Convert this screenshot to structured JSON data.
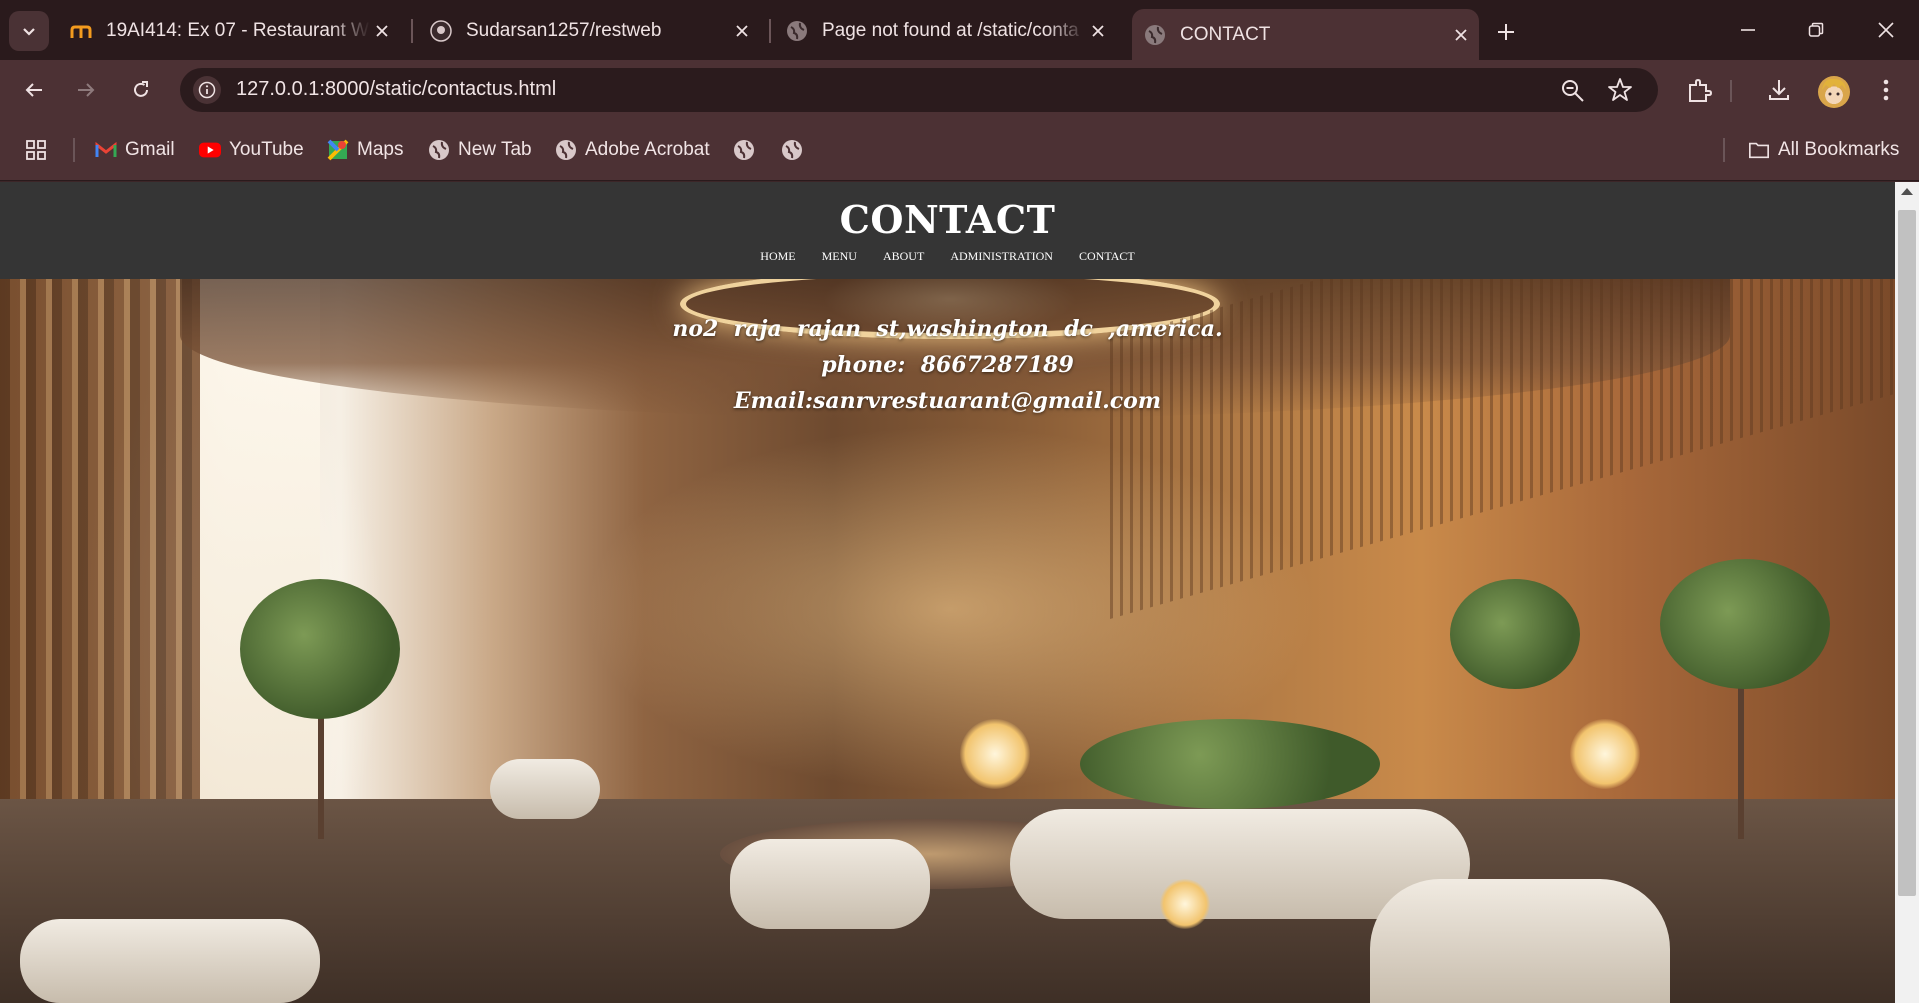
{
  "browser": {
    "tabs": [
      {
        "title": "19AI414: Ex 07 - Restaurant We",
        "favicon": "moodle-icon"
      },
      {
        "title": "Sudarsan1257/restweb",
        "favicon": "github-icon"
      },
      {
        "title": "Page not found at /static/conta",
        "favicon": "globe-icon"
      },
      {
        "title": "CONTACT",
        "favicon": "globe-icon",
        "active": true
      }
    ],
    "url": "127.0.0.1:8000/static/contactus.html",
    "bookmarks": [
      {
        "label": "Gmail",
        "icon": "gmail-icon"
      },
      {
        "label": "YouTube",
        "icon": "youtube-icon"
      },
      {
        "label": "Maps",
        "icon": "maps-icon"
      },
      {
        "label": "New Tab",
        "icon": "globe-icon"
      },
      {
        "label": "Adobe Acrobat",
        "icon": "globe-icon"
      },
      {
        "label": "",
        "icon": "globe-icon"
      },
      {
        "label": "",
        "icon": "globe-icon"
      }
    ],
    "all_bookmarks": "All Bookmarks",
    "colors": {
      "frame": "#2a1a1c",
      "toolbar": "#4c3134",
      "omnibox": "#2b1b1d"
    }
  },
  "site": {
    "title": "CONTACT",
    "nav": [
      "HOME",
      "MENU",
      "ABOUT",
      "ADMINISTRATION",
      "CONTACT"
    ],
    "contact": {
      "address": "no2  raja  rajan  st,washington  dc  ,america.",
      "phone": "phone:  8667287189",
      "email": "Email:sanrvrestuarant@gmail.com"
    },
    "colors": {
      "header_bg": "#353535",
      "text": "#ffffff"
    }
  }
}
